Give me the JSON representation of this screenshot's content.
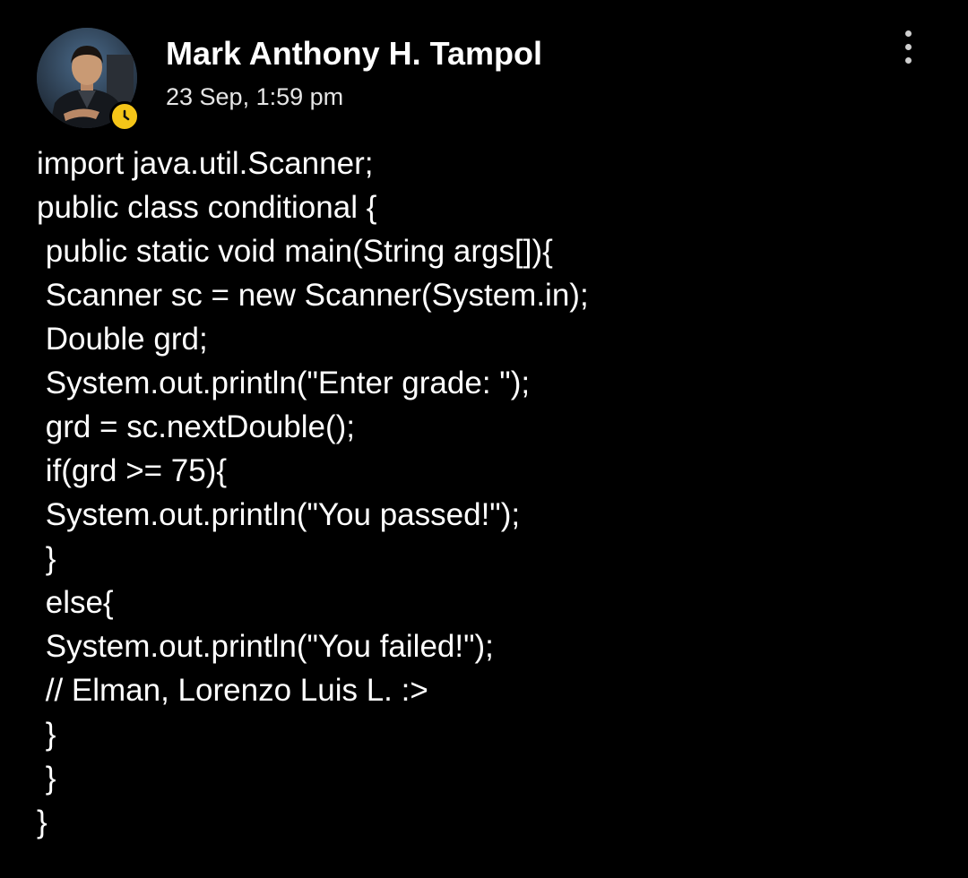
{
  "post": {
    "author": "Mark Anthony H. Tampol",
    "timestamp": "23 Sep, 1:59 pm",
    "avatar_icon": "user-photo",
    "status_icon": "clock-icon",
    "menu_icon": "more-vertical-icon",
    "lines": [
      "import java.util.Scanner;",
      "public class conditional {",
      " public static void main(String args[]){",
      " Scanner sc = new Scanner(System.in);",
      " Double grd;",
      " System.out.println(\"Enter grade: \");",
      " grd = sc.nextDouble();",
      " if(grd >= 75){",
      " System.out.println(\"You passed!\");",
      " }",
      " else{",
      " System.out.println(\"You failed!\");",
      " // Elman, Lorenzo Luis L. :>",
      " }",
      " }",
      "}"
    ]
  },
  "colors": {
    "background": "#000000",
    "text": "#ffffff",
    "status_badge": "#f5c518"
  }
}
